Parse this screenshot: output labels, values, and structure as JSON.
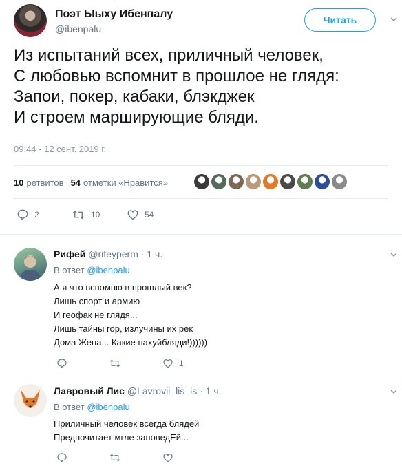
{
  "main_tweet": {
    "author_name": "Поэт Ыыху Ибенпалу",
    "handle": "@ibenpalu",
    "follow_label": "Читать",
    "text_lines": [
      "Из испытаний всех, приличный человек,",
      "С любовью вспомнит в прошлое не глядя:",
      "Запои, покер, кабаки, блэкджек",
      "И строем марширующие бляди."
    ],
    "timestamp": "09:44 - 12 сент. 2019 г.",
    "stats": {
      "retweets_count": "10",
      "retweets_label": "ретвитов",
      "likes_count": "54",
      "likes_label": "отметки «Нравится»"
    },
    "likers": [
      {
        "icon": "liker-avatar",
        "color": "#3a3a3a"
      },
      {
        "icon": "liker-avatar",
        "color": "#556b5a"
      },
      {
        "icon": "liker-avatar",
        "color": "#7a6a55"
      },
      {
        "icon": "liker-avatar",
        "color": "#b89a7a"
      },
      {
        "icon": "liker-avatar",
        "color": "#e07b2a"
      },
      {
        "icon": "liker-avatar",
        "color": "#4a4a4a"
      },
      {
        "icon": "liker-avatar",
        "color": "#5f7d4e"
      },
      {
        "icon": "liker-avatar",
        "color": "#2d4e9a"
      },
      {
        "icon": "liker-avatar",
        "color": "#8a8a8a"
      }
    ],
    "actions": {
      "reply_count": "2",
      "retweet_count": "10",
      "like_count": "54"
    }
  },
  "replies": [
    {
      "name": "Рифей",
      "handle": "@rifeyperm",
      "time": "· 1 ч.",
      "reply_to_label": "В ответ",
      "reply_to_handle": "@ibenpalu",
      "lines": [
        "А я что вспомню в прошлый век?",
        "Лишь спорт и армию",
        "И геофак не глядя...",
        "Лишь тайны гор, излучины их рек",
        "Дома Жена... Какие нахуйбляди!))))))"
      ],
      "like_count": "1"
    },
    {
      "name": "Лавровый Лис",
      "handle": "@Lavrovii_lis_is",
      "time": "· 1 ч.",
      "reply_to_label": "В ответ",
      "reply_to_handle": "@ibenpalu",
      "lines": [
        "Приличный человек всегда блядей",
        "Предпочитает мгле заповедЕй..."
      ],
      "like_count": ""
    }
  ],
  "colors": {
    "accent": "#1da1f2",
    "text": "#14171a",
    "muted": "#657786",
    "divider": "#e6ecf0"
  }
}
